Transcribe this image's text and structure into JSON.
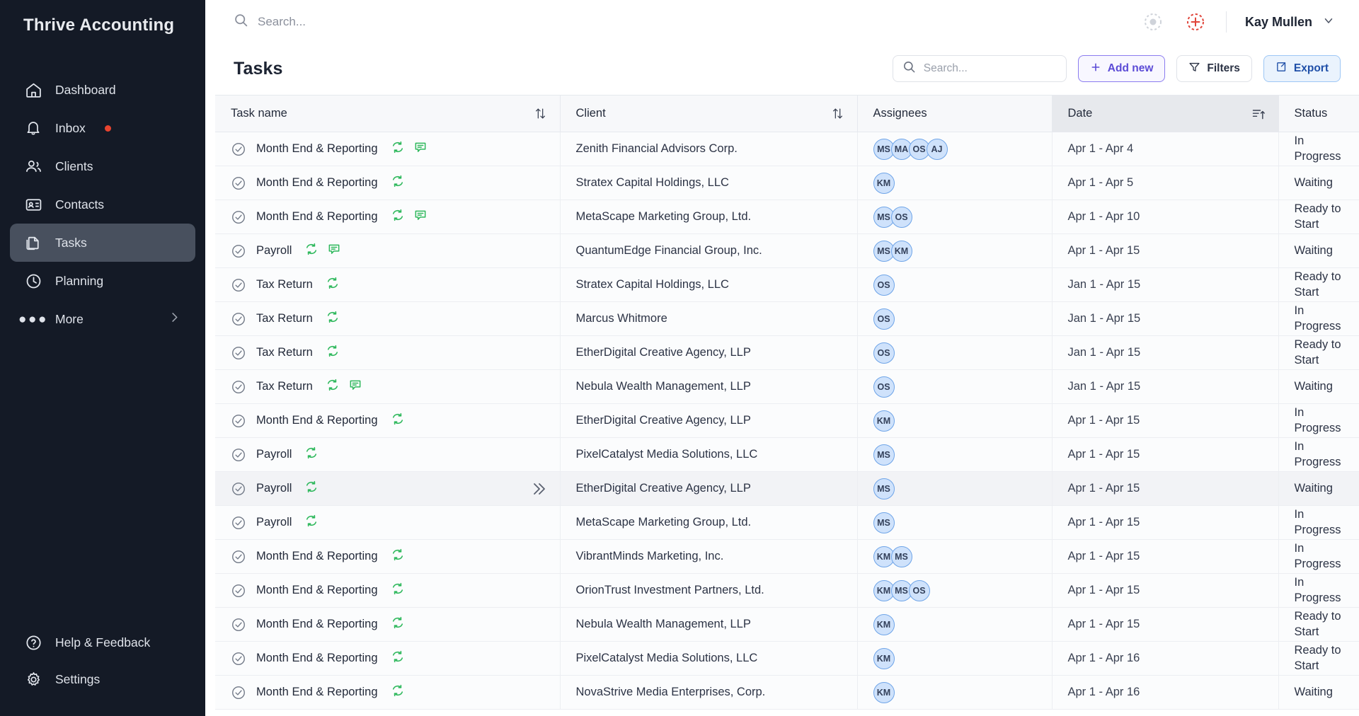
{
  "brand": {
    "name": "Thrive Accounting"
  },
  "sidebar": {
    "items": [
      {
        "label": "Dashboard",
        "icon": "home-icon",
        "active": false,
        "badge": false
      },
      {
        "label": "Inbox",
        "icon": "bell-icon",
        "active": false,
        "badge": true
      },
      {
        "label": "Clients",
        "icon": "people-icon",
        "active": false,
        "badge": false
      },
      {
        "label": "Contacts",
        "icon": "id-card-icon",
        "active": false,
        "badge": false
      },
      {
        "label": "Tasks",
        "icon": "documents-icon",
        "active": true,
        "badge": false
      },
      {
        "label": "Planning",
        "icon": "clock-icon",
        "active": false,
        "badge": false
      },
      {
        "label": "More",
        "icon": "ellipsis-icon",
        "active": false,
        "badge": false
      }
    ],
    "bottom": [
      {
        "label": "Help & Feedback",
        "icon": "question-circle-icon"
      },
      {
        "label": "Settings",
        "icon": "gear-icon"
      }
    ],
    "badge_color": "#e8442f",
    "active_color": "#48505e"
  },
  "topbar": {
    "search_placeholder": "Search...",
    "search_value": "",
    "notification_icon": "dotted-circle-icon",
    "add_icon": "dashed-plus-circle-icon",
    "add_icon_color": "#e0443a",
    "user_name": "Kay Mullen",
    "user_chevron": "chevron-down-icon"
  },
  "page": {
    "title": "Tasks",
    "search_placeholder": "Search...",
    "search_value": "",
    "add_new_label": "Add new",
    "filters_label": "Filters",
    "export_label": "Export",
    "accent_add": "#5b4bd6",
    "accent_export": "#1f4fa8"
  },
  "table": {
    "columns": [
      {
        "label": "Task name",
        "sort": "sort-updown-icon",
        "highlight": false
      },
      {
        "label": "Client",
        "sort": "sort-updown-icon",
        "highlight": false
      },
      {
        "label": "Assignees",
        "sort": null,
        "highlight": false
      },
      {
        "label": "Date",
        "sort": "sort-ascending-icon",
        "highlight": true
      },
      {
        "label": "Status",
        "sort": null,
        "highlight": false
      }
    ],
    "rows": [
      {
        "task": "Month End & Reporting",
        "recurring": true,
        "comment": true,
        "client": "Zenith Financial Advisors Corp.",
        "assignees": [
          "MS",
          "MA",
          "OS",
          "AJ"
        ],
        "date": "Apr 1 - Apr 4",
        "status": "In Progress",
        "hovered": false
      },
      {
        "task": "Month End & Reporting",
        "recurring": true,
        "comment": false,
        "client": "Stratex Capital Holdings, LLC",
        "assignees": [
          "KM"
        ],
        "date": "Apr 1 - Apr 5",
        "status": "Waiting",
        "hovered": false
      },
      {
        "task": "Month End & Reporting",
        "recurring": true,
        "comment": true,
        "client": "MetaScape Marketing Group, Ltd.",
        "assignees": [
          "MS",
          "OS"
        ],
        "date": "Apr 1 - Apr 10",
        "status": "Ready to Start",
        "hovered": false
      },
      {
        "task": "Payroll",
        "recurring": true,
        "comment": true,
        "client": "QuantumEdge Financial Group, Inc.",
        "assignees": [
          "MS",
          "KM"
        ],
        "date": "Apr 1 - Apr 15",
        "status": "Waiting",
        "hovered": false
      },
      {
        "task": "Tax Return",
        "recurring": true,
        "comment": false,
        "client": "Stratex Capital Holdings, LLC",
        "assignees": [
          "OS"
        ],
        "date": "Jan 1 - Apr 15",
        "status": "Ready to Start",
        "hovered": false
      },
      {
        "task": "Tax Return",
        "recurring": true,
        "comment": false,
        "client": "Marcus Whitmore",
        "assignees": [
          "OS"
        ],
        "date": "Jan 1 - Apr 15",
        "status": "In Progress",
        "hovered": false
      },
      {
        "task": "Tax Return",
        "recurring": true,
        "comment": false,
        "client": "EtherDigital Creative Agency, LLP",
        "assignees": [
          "OS"
        ],
        "date": "Jan 1 - Apr 15",
        "status": "Ready to Start",
        "hovered": false
      },
      {
        "task": "Tax Return",
        "recurring": true,
        "comment": true,
        "client": "Nebula Wealth Management, LLP",
        "assignees": [
          "OS"
        ],
        "date": "Jan 1 - Apr 15",
        "status": "Waiting",
        "hovered": false
      },
      {
        "task": "Month End & Reporting",
        "recurring": true,
        "comment": false,
        "client": "EtherDigital Creative Agency, LLP",
        "assignees": [
          "KM"
        ],
        "date": "Apr 1 - Apr 15",
        "status": "In Progress",
        "hovered": false
      },
      {
        "task": "Payroll",
        "recurring": true,
        "comment": false,
        "client": "PixelCatalyst Media Solutions, LLC",
        "assignees": [
          "MS"
        ],
        "date": "Apr 1 - Apr 15",
        "status": "In Progress",
        "hovered": false
      },
      {
        "task": "Payroll",
        "recurring": true,
        "comment": false,
        "client": "EtherDigital Creative Agency, LLP",
        "assignees": [
          "MS"
        ],
        "date": "Apr 1 - Apr 15",
        "status": "Waiting",
        "hovered": true
      },
      {
        "task": "Payroll",
        "recurring": true,
        "comment": false,
        "client": "MetaScape Marketing Group, Ltd.",
        "assignees": [
          "MS"
        ],
        "date": "Apr 1 - Apr 15",
        "status": "In Progress",
        "hovered": false
      },
      {
        "task": "Month End & Reporting",
        "recurring": true,
        "comment": false,
        "client": "VibrantMinds Marketing, Inc.",
        "assignees": [
          "KM",
          "MS"
        ],
        "date": "Apr 1 - Apr 15",
        "status": "In Progress",
        "hovered": false
      },
      {
        "task": "Month End & Reporting",
        "recurring": true,
        "comment": false,
        "client": "OrionTrust Investment Partners, Ltd.",
        "assignees": [
          "KM",
          "MS",
          "OS"
        ],
        "date": "Apr 1 - Apr 15",
        "status": "In Progress",
        "hovered": false
      },
      {
        "task": "Month End & Reporting",
        "recurring": true,
        "comment": false,
        "client": "Nebula Wealth Management, LLP",
        "assignees": [
          "KM"
        ],
        "date": "Apr 1 - Apr 15",
        "status": "Ready to Start",
        "hovered": false
      },
      {
        "task": "Month End & Reporting",
        "recurring": true,
        "comment": false,
        "client": "PixelCatalyst Media Solutions, LLC",
        "assignees": [
          "KM"
        ],
        "date": "Apr 1 - Apr 16",
        "status": "Ready to Start",
        "hovered": false
      },
      {
        "task": "Month End & Reporting",
        "recurring": true,
        "comment": false,
        "client": "NovaStrive Media Enterprises, Corp.",
        "assignees": [
          "KM"
        ],
        "date": "Apr 1 - Apr 16",
        "status": "Waiting",
        "hovered": false
      }
    ],
    "recurring_icon": "recurring-arrows-icon",
    "recurring_color": "#2eb85c",
    "comment_icon": "comment-icon",
    "check_icon": "check-circle-icon",
    "expand_icon": "double-chevron-right-icon"
  }
}
